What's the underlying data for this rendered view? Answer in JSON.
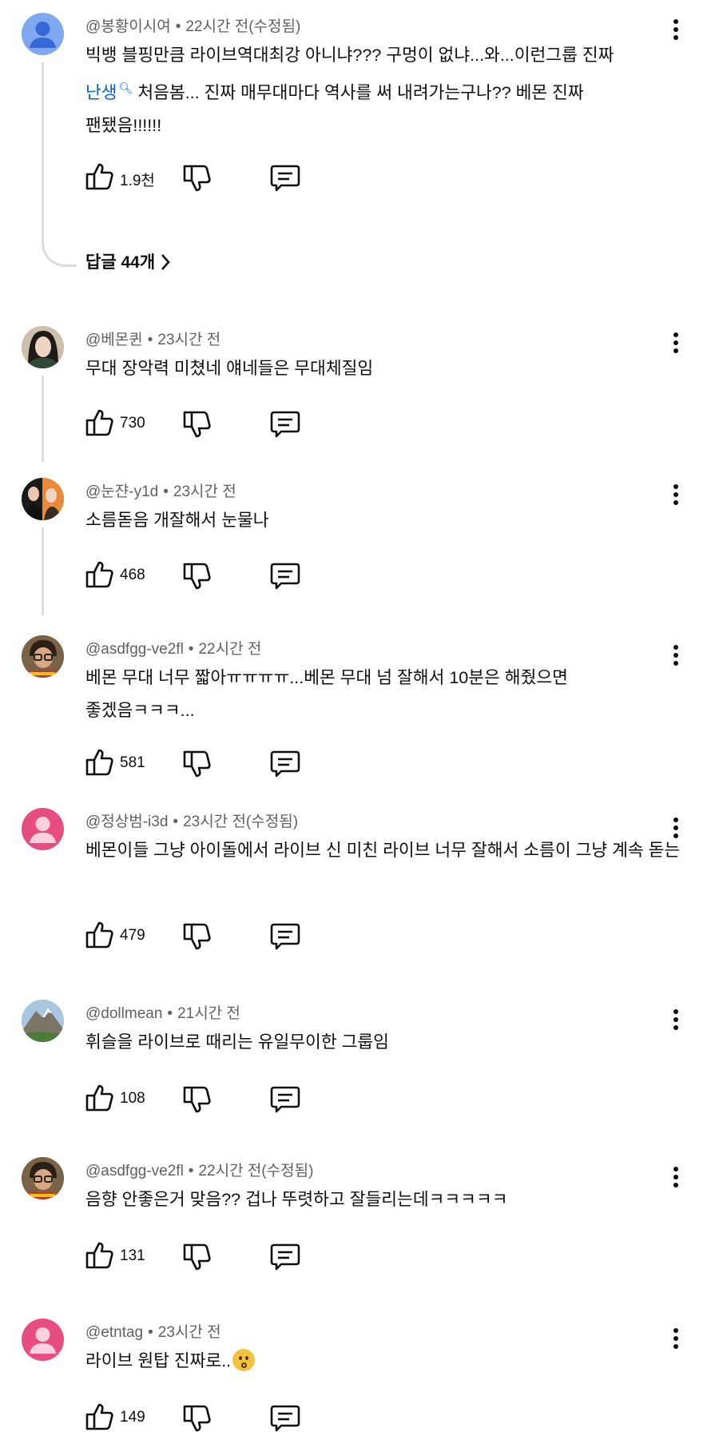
{
  "comments": [
    {
      "author": "@봉황이시여",
      "time": "22시간 전(수정됨)",
      "text_line1": "빅뱅 블핑만큼 라이브역대최강 아니냐??? 구멍이 없냐...와...이런그룹 진짜",
      "text_link": "난생",
      "text_line2_rest": "처음봄... 진짜 매무대마다 역사를 써 내려가는구나?? 베몬 진짜",
      "text_line3": "팬됐음!!!!!!",
      "likes": "1.9천",
      "replies_label": "답글 44개",
      "avatar": "default-person-blue"
    },
    {
      "author": "@베몬퀸",
      "time": "23시간 전",
      "text": "무대 장악력 미쳤네 얘네들은 무대체질임",
      "likes": "730",
      "avatar": "photo-dark-hair"
    },
    {
      "author": "@눈쟌-y1d",
      "time": "23시간 전",
      "text": "소름돋음 개잘해서 눈물나",
      "likes": "468",
      "avatar": "photo-two-people"
    },
    {
      "author": "@asdfgg-ve2fl",
      "time": "22시간 전",
      "text": "베몬 무대 너무 짧아ㅠㅠㅠㅠ...베몬 무대 넘 잘해서 10분은 해줬으면 좋겠음ㅋㅋㅋ...",
      "likes": "581",
      "avatar": "photo-glasses-man"
    },
    {
      "author": "@정상범-i3d",
      "time": "23시간 전(수정됨)",
      "text": "베몬이들 그냥 아이돌에서 라이브 신 미친 라이브 너무 잘해서 소름이 그냥 계속 돋는",
      "likes": "479",
      "avatar": "default-person-pink"
    },
    {
      "author": "@dollmean",
      "time": "21시간 전",
      "text": "휘슬을 라이브로 때리는 유일무이한 그룹임",
      "likes": "108",
      "avatar": "photo-mountain"
    },
    {
      "author": "@asdfgg-ve2fl",
      "time": "22시간 전(수정됨)",
      "text": "음향 안좋은거 맞음?? 겁나 뚜렷하고 잘들리는데ㅋㅋㅋㅋㅋ",
      "likes": "131",
      "avatar": "photo-glasses-man"
    },
    {
      "author": "@etntag",
      "time": "23시간 전",
      "text": "라이브 원탑 진짜로..",
      "emoji": "hushed-face-emoji",
      "likes": "149",
      "avatar": "default-person-pink"
    }
  ],
  "icons": {
    "like": "thumbs-up-icon",
    "dislike": "thumbs-down-icon",
    "reply": "comment-icon",
    "more": "more-vertical-icon",
    "chevron": "chevron-right-icon",
    "link_search": "search-icon"
  },
  "colors": {
    "link": "#065fd4",
    "meta": "#606060",
    "avatar_blue": "#7fa8f0",
    "avatar_pink": "#e84d80"
  }
}
